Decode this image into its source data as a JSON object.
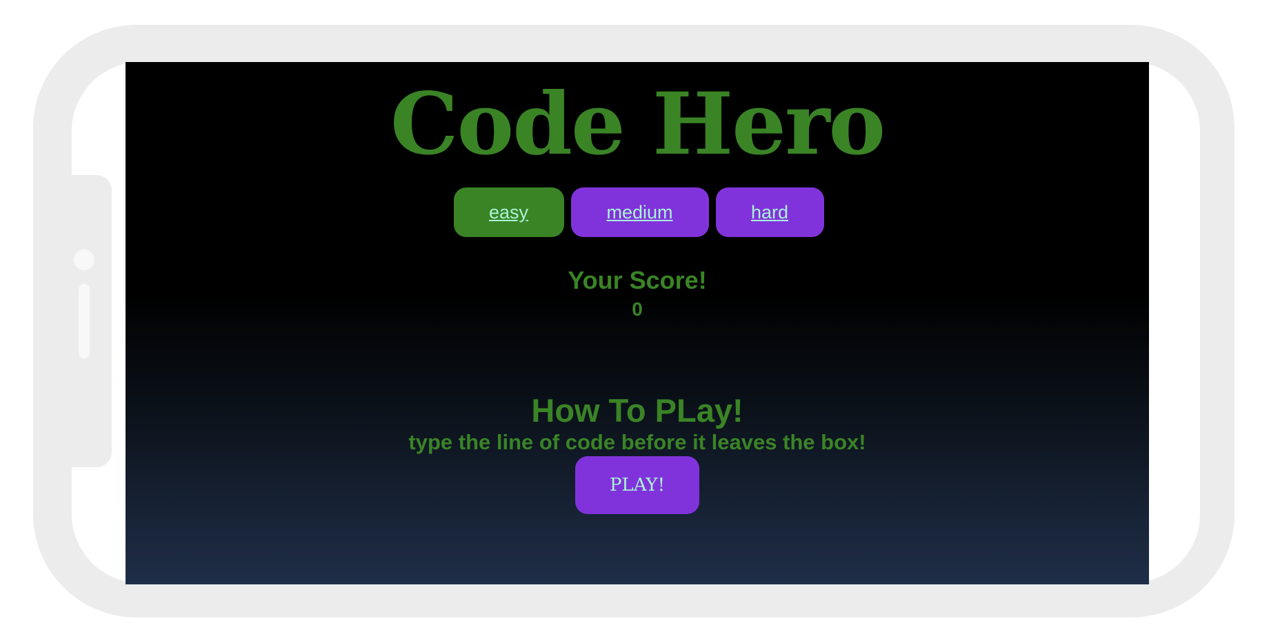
{
  "game": {
    "title": "Code Hero",
    "difficulty": {
      "options": [
        "easy",
        "medium",
        "hard"
      ],
      "selected": "easy"
    },
    "score": {
      "label": "Your Score!",
      "value": "0"
    },
    "how_to_play": {
      "title": "How To PLay!",
      "instructions": "type the line of code before it leaves the box!"
    },
    "play_button": "PLAY!"
  },
  "colors": {
    "accent_green": "#3a8426",
    "accent_purple": "#8133db",
    "button_text": "#a9f5d8",
    "background_top": "#000000",
    "background_bottom": "#1f2e48",
    "device_frame": "#ececec"
  }
}
